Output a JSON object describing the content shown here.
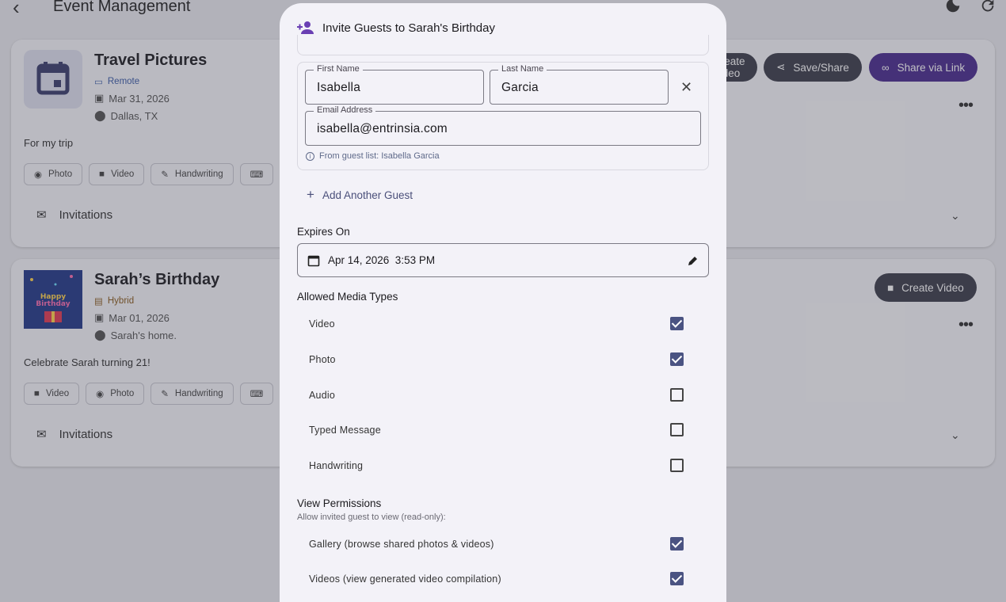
{
  "app": {
    "title": "Event Management"
  },
  "events": [
    {
      "name": "Travel Pictures",
      "mode": "Remote",
      "date": "Mar 31, 2026",
      "location": "Dallas, TX",
      "description": "For my trip",
      "chips": [
        "Photo",
        "Video",
        "Handwriting"
      ],
      "invitations_label": "Invitations",
      "actions": {
        "create_video": "Create Video",
        "save_share": "Save/Share",
        "share_link": "Share via Link"
      }
    },
    {
      "name": "Sarah’s Birthday",
      "mode": "Hybrid",
      "date": "Mar 01, 2026",
      "location": "Sarah's home.",
      "description": "Celebrate Sarah turning 21!",
      "chips": [
        "Video",
        "Photo",
        "Handwriting"
      ],
      "invitations_label": "Invitations",
      "actions": {
        "create_video": "Create Video"
      }
    }
  ],
  "dialog": {
    "title": "Invite Guests to Sarah's Birthday",
    "guest": {
      "first_name_label": "First Name",
      "first_name": "Isabella",
      "last_name_label": "Last Name",
      "last_name": "Garcia",
      "email_label": "Email Address",
      "email": "isabella@entrinsia.com",
      "hint": "From guest list: Isabella Garcia"
    },
    "add_guest": "Add Another Guest",
    "expires_label": "Expires On",
    "expires_value": "Apr 14, 2026  3:53 PM",
    "media_label": "Allowed Media Types",
    "media_types": [
      {
        "label": "Video",
        "checked": true
      },
      {
        "label": "Photo",
        "checked": true
      },
      {
        "label": "Audio",
        "checked": false
      },
      {
        "label": "Typed Message",
        "checked": false
      },
      {
        "label": "Handwriting",
        "checked": false
      }
    ],
    "view_permissions_label": "View Permissions",
    "view_permissions_sub": "Allow invited guest to view (read-only):",
    "permissions": [
      {
        "label": "Gallery (browse shared photos & videos)",
        "checked": true
      },
      {
        "label": "Videos (view generated video compilation)",
        "checked": true
      }
    ]
  },
  "colors": {
    "accent": "#4a5382",
    "share_link": "#4b2d8f",
    "dark_pill": "#3d3f4c"
  }
}
